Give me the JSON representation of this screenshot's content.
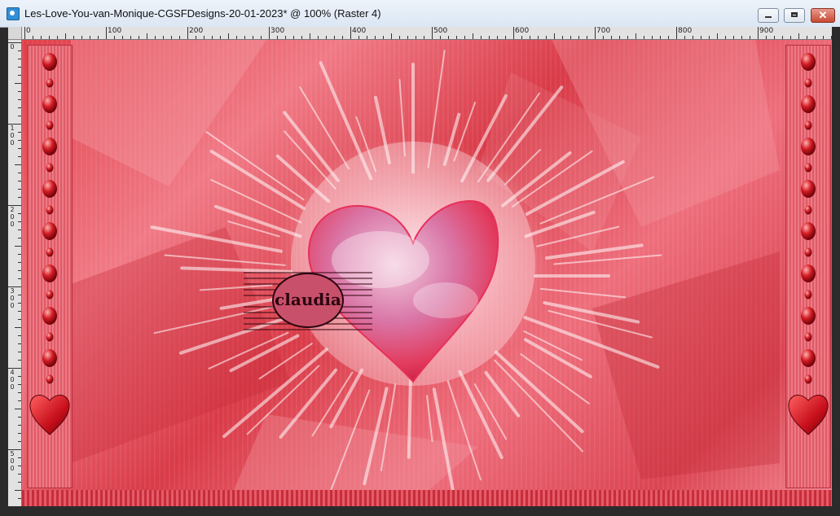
{
  "window": {
    "title": "Les-Love-You-van-Monique-CGSFDesigns-20-01-2023* @ 100% (Raster 4)",
    "controls": {
      "minimize": "minimize",
      "maximize": "maximize",
      "close": "✕"
    }
  },
  "ruler": {
    "horizontal_labels": [
      "0",
      "100",
      "200",
      "300",
      "400",
      "500",
      "600",
      "700",
      "800",
      "900"
    ],
    "vertical_labels": [
      "0",
      "100",
      "200",
      "300",
      "400",
      "500"
    ]
  },
  "artwork": {
    "watermark_text": "claudia",
    "colors": {
      "primary": "#e0404a",
      "highlight": "#f28a94",
      "heart": "#e23a5c"
    }
  }
}
